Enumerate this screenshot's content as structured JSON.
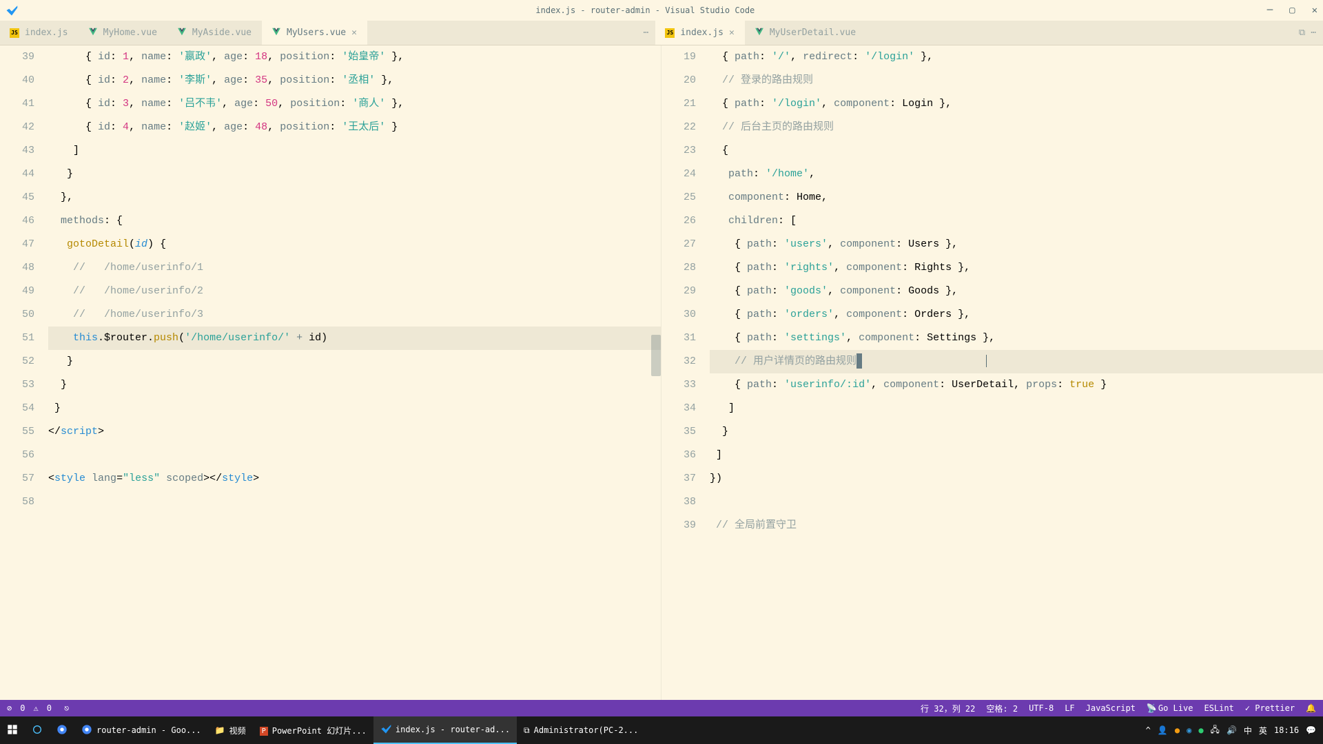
{
  "window": {
    "title": "index.js - router-admin - Visual Studio Code"
  },
  "tabs_left": [
    {
      "label": "index.js",
      "type": "js",
      "active": false,
      "close": false
    },
    {
      "label": "MyHome.vue",
      "type": "vue",
      "active": false,
      "close": false
    },
    {
      "label": "MyAside.vue",
      "type": "vue",
      "active": false,
      "close": false
    },
    {
      "label": "MyUsers.vue",
      "type": "vue",
      "active": true,
      "close": true
    }
  ],
  "tabs_right": [
    {
      "label": "index.js",
      "type": "js",
      "active": true,
      "close": true
    },
    {
      "label": "MyUserDetail.vue",
      "type": "vue",
      "active": false,
      "close": false
    }
  ],
  "left_editor": {
    "lines": [
      {
        "n": "39",
        "html": "      { <span class='tk-var'>id</span>: <span class='tk-num'>1</span>, <span class='tk-var'>name</span>: <span class='tk-str'>'嬴政'</span>, <span class='tk-var'>age</span>: <span class='tk-num'>18</span>, <span class='tk-var'>position</span>: <span class='tk-str'>'始皇帝'</span> },"
      },
      {
        "n": "40",
        "html": "      { <span class='tk-var'>id</span>: <span class='tk-num'>2</span>, <span class='tk-var'>name</span>: <span class='tk-str'>'李斯'</span>, <span class='tk-var'>age</span>: <span class='tk-num'>35</span>, <span class='tk-var'>position</span>: <span class='tk-str'>'丞相'</span> },"
      },
      {
        "n": "41",
        "html": "      { <span class='tk-var'>id</span>: <span class='tk-num'>3</span>, <span class='tk-var'>name</span>: <span class='tk-str'>'吕不韦'</span>, <span class='tk-var'>age</span>: <span class='tk-num'>50</span>, <span class='tk-var'>position</span>: <span class='tk-str'>'商人'</span> },"
      },
      {
        "n": "42",
        "html": "      { <span class='tk-var'>id</span>: <span class='tk-num'>4</span>, <span class='tk-var'>name</span>: <span class='tk-str'>'赵姬'</span>, <span class='tk-var'>age</span>: <span class='tk-num'>48</span>, <span class='tk-var'>position</span>: <span class='tk-str'>'王太后'</span> }"
      },
      {
        "n": "43",
        "html": "    ]"
      },
      {
        "n": "44",
        "html": "   }"
      },
      {
        "n": "45",
        "html": "  },"
      },
      {
        "n": "46",
        "html": "  <span class='tk-var'>methods</span>: {"
      },
      {
        "n": "47",
        "html": "   <span class='tk-fn'>gotoDetail</span>(<span class='tk-param'>id</span>) {"
      },
      {
        "n": "48",
        "html": "    <span class='tk-comm'>//   /home/userinfo/1</span>"
      },
      {
        "n": "49",
        "html": "    <span class='tk-comm'>//   /home/userinfo/2</span>"
      },
      {
        "n": "50",
        "html": "    <span class='tk-comm'>//   /home/userinfo/3</span>"
      },
      {
        "n": "51",
        "html": "    <span class='tk-key'>this</span>.$router.<span class='tk-fn'>push</span>(<span class='tk-str'>'/home/userinfo/'</span> <span class='tk-op'>+</span> id)",
        "highlight": true
      },
      {
        "n": "52",
        "html": "   }"
      },
      {
        "n": "53",
        "html": "  }"
      },
      {
        "n": "54",
        "html": " }"
      },
      {
        "n": "55",
        "html": "&lt;/<span class='tk-tag'>script</span>&gt;"
      },
      {
        "n": "56",
        "html": ""
      },
      {
        "n": "57",
        "html": "&lt;<span class='tk-tag'>style</span> <span class='tk-attr'>lang</span>=<span class='tk-str'>\"less\"</span> <span class='tk-attr'>scoped</span>&gt;&lt;/<span class='tk-tag'>style</span>&gt;"
      },
      {
        "n": "58",
        "html": ""
      }
    ]
  },
  "right_editor": {
    "lines": [
      {
        "n": "19",
        "html": "  { <span class='tk-var'>path</span>: <span class='tk-str'>'/'</span>, <span class='tk-var'>redirect</span>: <span class='tk-str'>'/login'</span> },"
      },
      {
        "n": "20",
        "html": "  <span class='tk-comm'>// 登录的路由规则</span>"
      },
      {
        "n": "21",
        "html": "  { <span class='tk-var'>path</span>: <span class='tk-str'>'/login'</span>, <span class='tk-var'>component</span>: Login },"
      },
      {
        "n": "22",
        "html": "  <span class='tk-comm'>// 后台主页的路由规则</span>"
      },
      {
        "n": "23",
        "html": "  {"
      },
      {
        "n": "24",
        "html": "   <span class='tk-var'>path</span>: <span class='tk-str'>'/home'</span>,"
      },
      {
        "n": "25",
        "html": "   <span class='tk-var'>component</span>: Home,"
      },
      {
        "n": "26",
        "html": "   <span class='tk-var'>children</span>: ["
      },
      {
        "n": "27",
        "html": "    { <span class='tk-var'>path</span>: <span class='tk-str'>'users'</span>, <span class='tk-var'>component</span>: Users },"
      },
      {
        "n": "28",
        "html": "    { <span class='tk-var'>path</span>: <span class='tk-str'>'rights'</span>, <span class='tk-var'>component</span>: Rights },"
      },
      {
        "n": "29",
        "html": "    { <span class='tk-var'>path</span>: <span class='tk-str'>'goods'</span>, <span class='tk-var'>component</span>: Goods },"
      },
      {
        "n": "30",
        "html": "    { <span class='tk-var'>path</span>: <span class='tk-str'>'orders'</span>, <span class='tk-var'>component</span>: Orders },"
      },
      {
        "n": "31",
        "html": "    { <span class='tk-var'>path</span>: <span class='tk-str'>'settings'</span>, <span class='tk-var'>component</span>: Settings },"
      },
      {
        "n": "32",
        "html": "    <span class='tk-comm'>// 用户详情页的路由规则</span><span class='cursor block'></span>                    <span class='text-cursor-blink'></span>",
        "highlight": true
      },
      {
        "n": "33",
        "html": "    { <span class='tk-var'>path</span>: <span class='tk-str'>'userinfo/:id'</span>, <span class='tk-var'>component</span>: UserDetail, <span class='tk-var'>props</span>: <span class='tk-true'>true</span> }"
      },
      {
        "n": "34",
        "html": "   ]"
      },
      {
        "n": "35",
        "html": "  }"
      },
      {
        "n": "36",
        "html": " ]"
      },
      {
        "n": "37",
        "html": "})"
      },
      {
        "n": "38",
        "html": ""
      },
      {
        "n": "39",
        "html": " <span class='tk-comm'>// 全局前置守卫</span>"
      }
    ]
  },
  "statusbar": {
    "errors": "0",
    "warnings": "0",
    "cursor": "行 32，列 22",
    "spaces": "空格: 2",
    "encoding": "UTF-8",
    "eol": "LF",
    "lang": "JavaScript",
    "golive": "Go Live",
    "eslint": "ESLint",
    "prettier": "Prettier"
  },
  "taskbar": {
    "items": [
      {
        "label": "",
        "icon": "win"
      },
      {
        "label": "",
        "icon": "cortana"
      },
      {
        "label": "",
        "icon": "chrome"
      },
      {
        "label": "router-admin - Goo...",
        "icon": "chrome2"
      },
      {
        "label": "视频",
        "icon": "folder"
      },
      {
        "label": "PowerPoint 幻灯片...",
        "icon": "ppt"
      },
      {
        "label": "index.js - router-ad...",
        "icon": "vscode",
        "active": true
      },
      {
        "label": "Administrator(PC-2...",
        "icon": "terminal"
      }
    ],
    "time": "18:16",
    "ime": "英",
    "ime2": "中"
  }
}
